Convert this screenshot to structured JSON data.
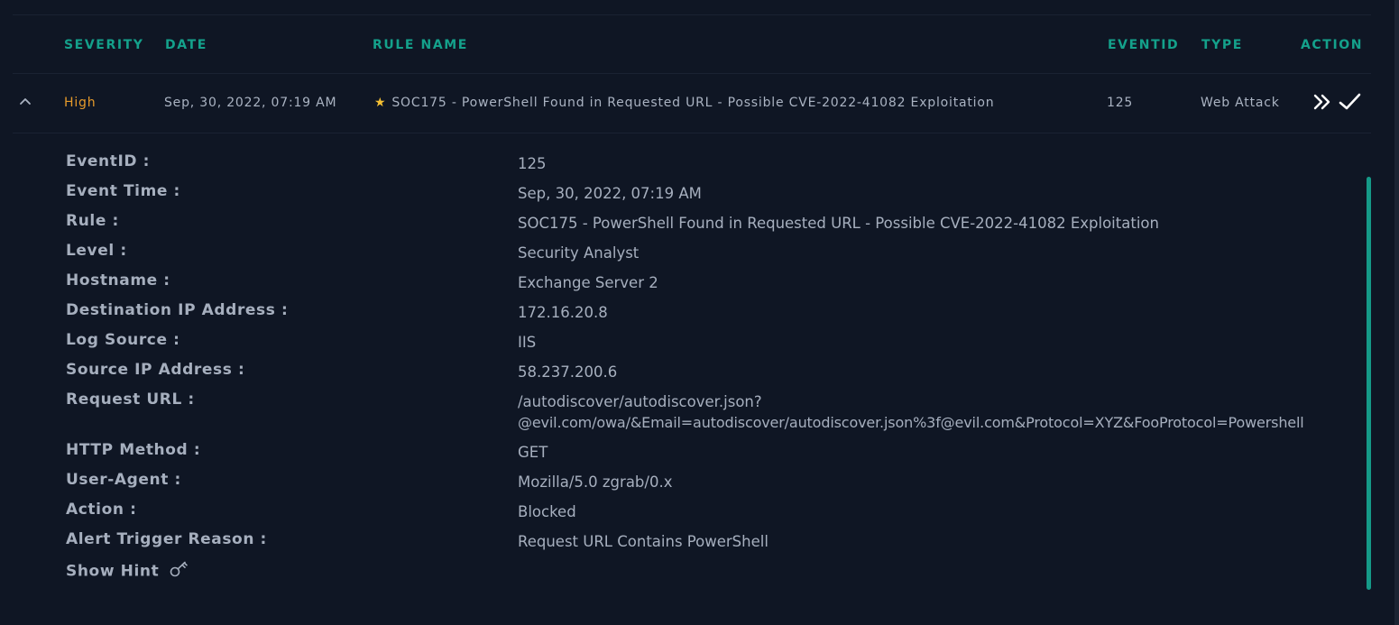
{
  "table": {
    "headers": {
      "severity": "SEVERITY",
      "date": "DATE",
      "rule_name": "RULE NAME",
      "eventid": "EVENTID",
      "type": "TYPE",
      "action": "ACTION"
    },
    "row": {
      "severity": "High",
      "date": "Sep, 30, 2022, 07:19 AM",
      "rule_name": "SOC175 - PowerShell Found in Requested URL - Possible CVE-2022-41082 Exploitation",
      "eventid": "125",
      "type": "Web Attack",
      "severity_color": "#e69a2b",
      "star_icon": "star-icon",
      "collapse_icon": "chevron-up-icon",
      "action_icons": [
        "double-chevron-right-icon",
        "checkmark-icon"
      ]
    }
  },
  "details": {
    "fields": [
      {
        "label": "EventID :",
        "value": "125"
      },
      {
        "label": "Event Time :",
        "value": "Sep, 30, 2022, 07:19 AM"
      },
      {
        "label": "Rule :",
        "value": "SOC175 - PowerShell Found in Requested URL - Possible CVE-2022-41082 Exploitation"
      },
      {
        "label": "Level :",
        "value": "Security Analyst"
      },
      {
        "label": "Hostname :",
        "value": "Exchange Server 2"
      },
      {
        "label": "Destination IP Address :",
        "value": "172.16.20.8"
      },
      {
        "label": "Log Source :",
        "value": "IIS"
      },
      {
        "label": "Source IP Address :",
        "value": "58.237.200.6"
      },
      {
        "label": "Request URL :",
        "value": "/autodiscover/autodiscover.json?",
        "value_line2": "@evil.com/owa/&Email=autodiscover/autodiscover.json%3f@evil.com&Protocol=XYZ&FooProtocol=Powershell"
      },
      {
        "label": "HTTP Method :",
        "value": "GET"
      },
      {
        "label": "User-Agent :",
        "value": "Mozilla/5.0 zgrab/0.x"
      },
      {
        "label": "Action :",
        "value": "Blocked"
      },
      {
        "label": "Alert Trigger Reason :",
        "value": "Request URL Contains PowerShell"
      }
    ],
    "show_hint": "Show Hint",
    "hint_icon": "key-icon"
  },
  "colors": {
    "accent": "#14a18b",
    "background": "#0f1624",
    "text": "#aab3c2",
    "severity_high": "#e69a2b",
    "star": "#f5c033"
  }
}
